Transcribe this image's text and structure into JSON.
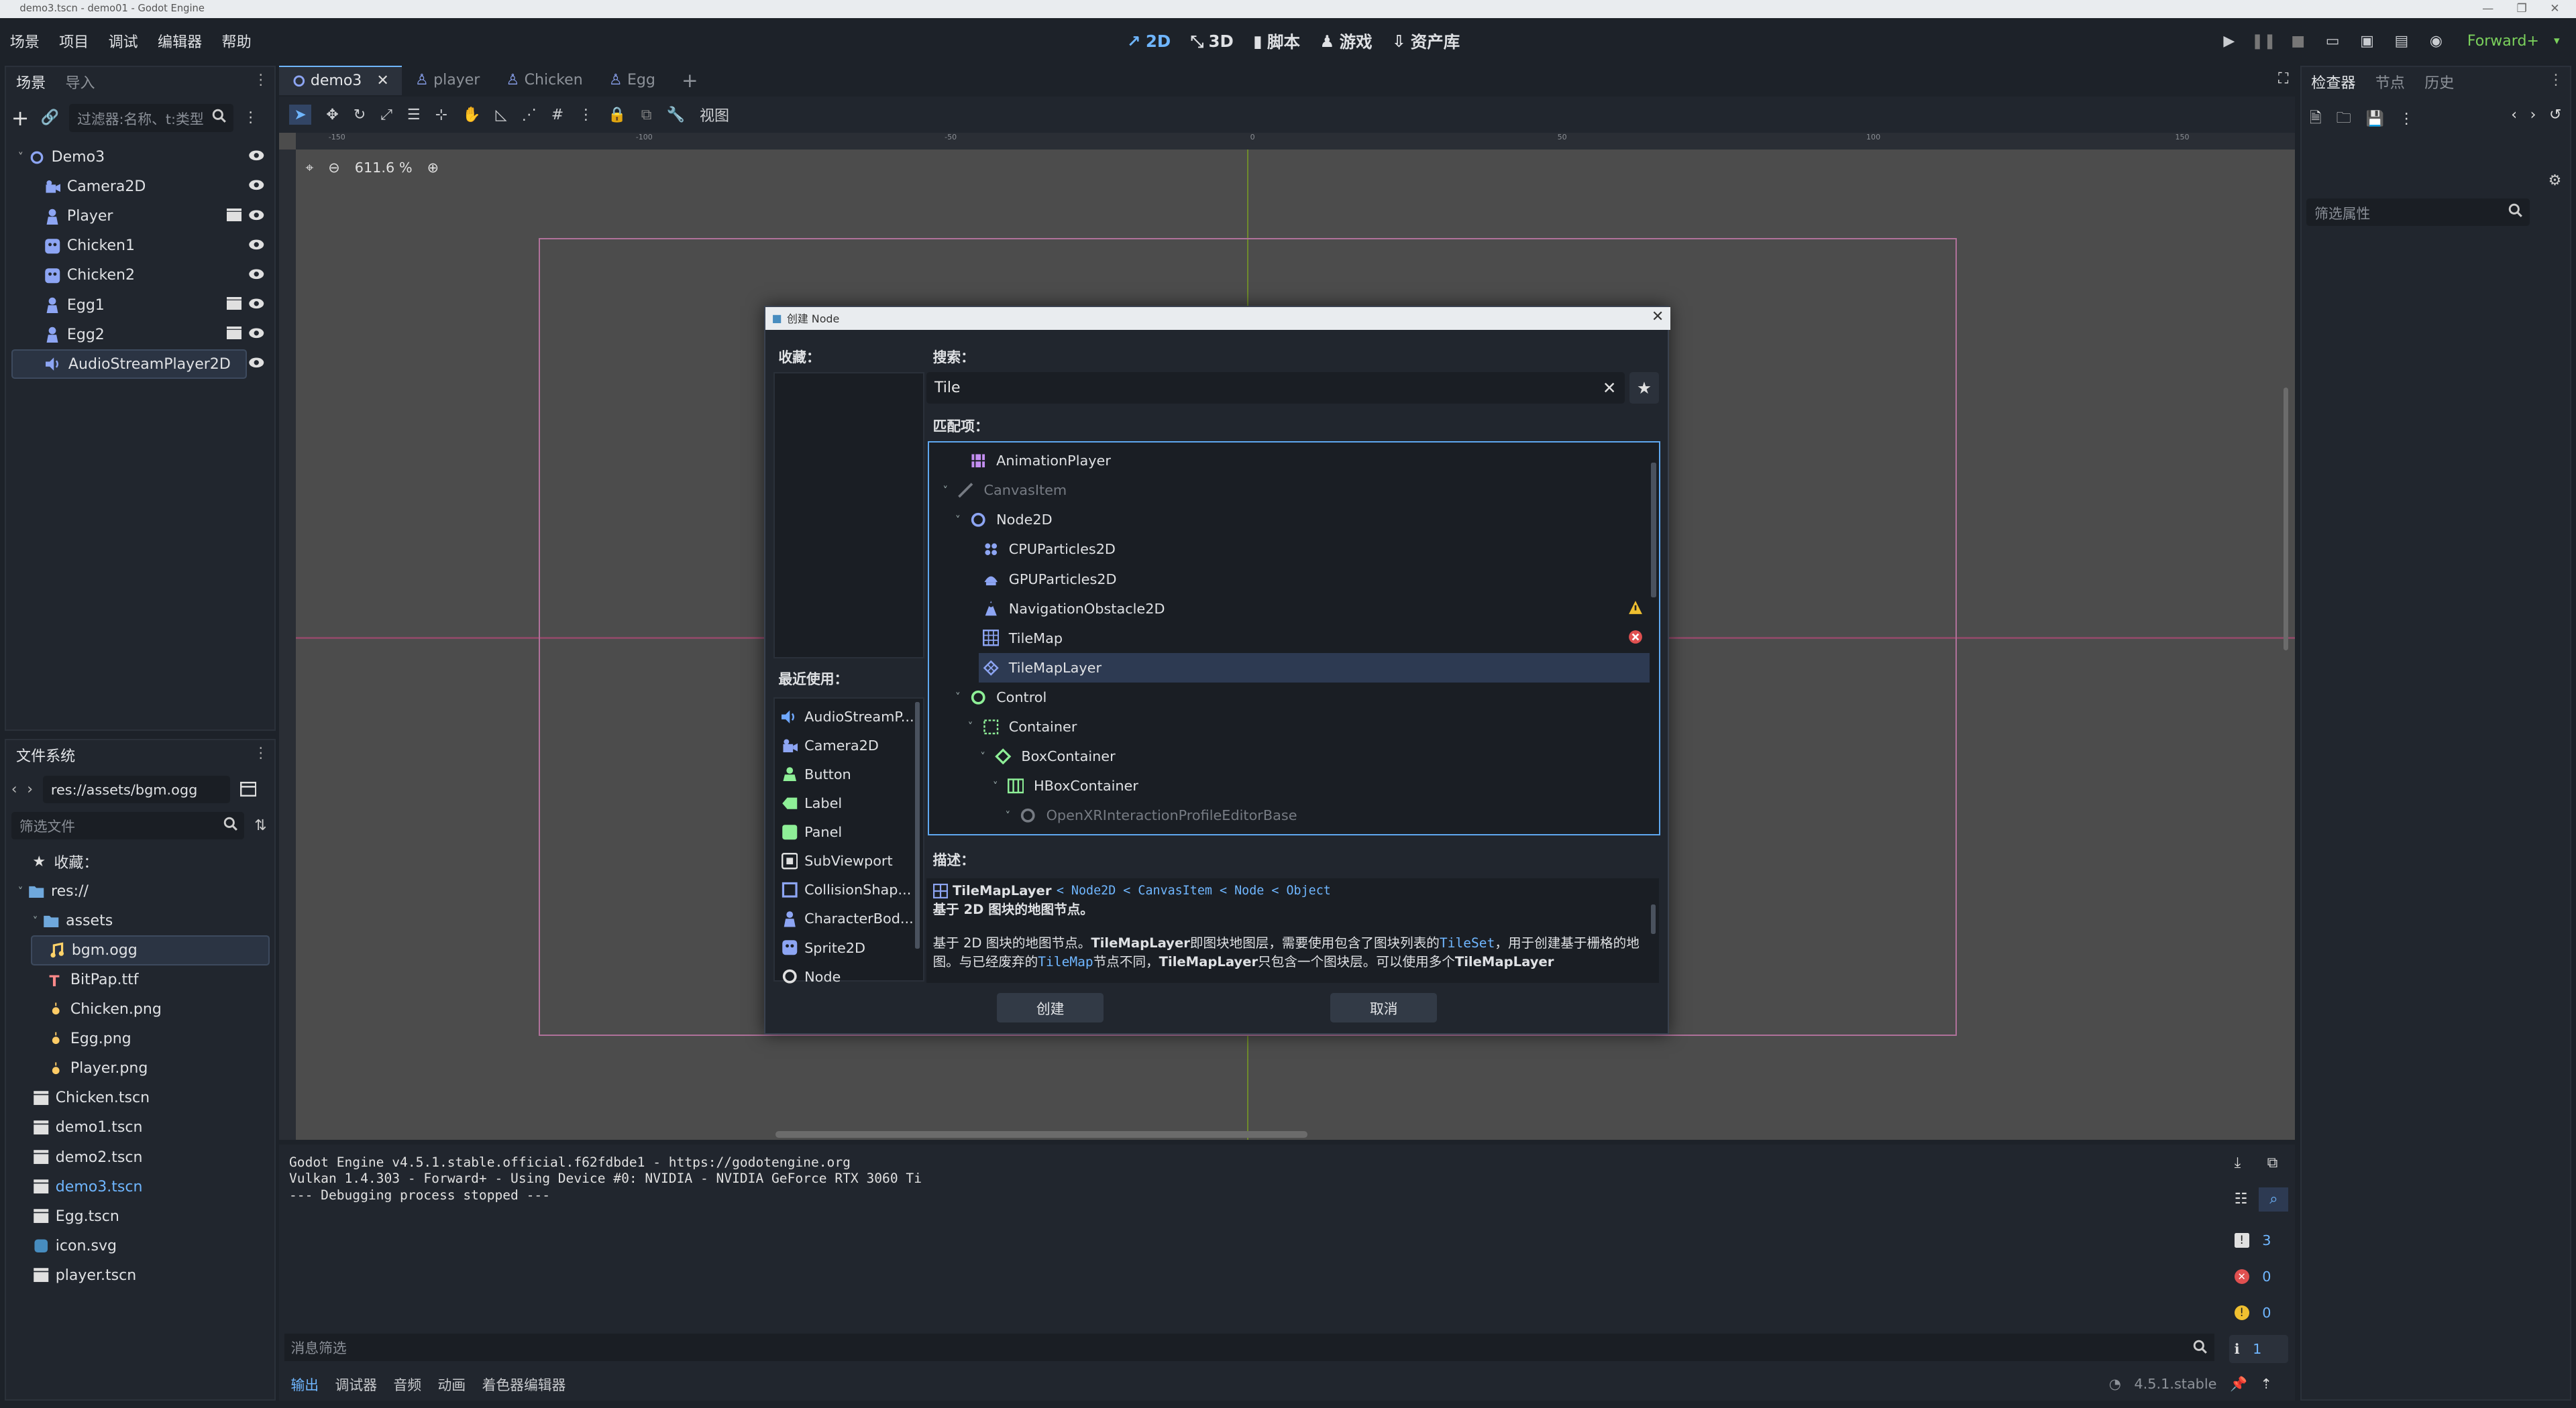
{
  "window": {
    "title": "demo3.tscn - demo01 - Godot Engine"
  },
  "menu": [
    "场景",
    "项目",
    "调试",
    "编辑器",
    "帮助"
  ],
  "main_screens": [
    "2D",
    "3D",
    "脚本",
    "游戏",
    "资产库"
  ],
  "renderer": "Forward+",
  "scene_dock": {
    "tabs": [
      "场景",
      "导入"
    ],
    "filter_placeholder": "过滤器:名称、t:类型",
    "nodes": [
      {
        "name": "Demo3",
        "icon": "node2d-icon"
      },
      {
        "name": "Camera2D",
        "icon": "camera2d-icon"
      },
      {
        "name": "Player",
        "icon": "characterbody-icon"
      },
      {
        "name": "Chicken1",
        "icon": "sprite-icon"
      },
      {
        "name": "Chicken2",
        "icon": "sprite-icon"
      },
      {
        "name": "Egg1",
        "icon": "characterbody-icon"
      },
      {
        "name": "Egg2",
        "icon": "characterbody-icon"
      },
      {
        "name": "AudioStreamPlayer2D",
        "icon": "speaker-icon"
      }
    ]
  },
  "filesystem": {
    "tab": "文件系统",
    "path": "res://assets/bgm.ogg",
    "filter_placeholder": "筛选文件",
    "favorites_label": "收藏：",
    "items": [
      {
        "name": "res://",
        "indent": 0,
        "type": "folder"
      },
      {
        "name": "assets",
        "indent": 1,
        "type": "folder"
      },
      {
        "name": "bgm.ogg",
        "indent": 2,
        "type": "audio"
      },
      {
        "name": "BitPap.ttf",
        "indent": 2,
        "type": "font"
      },
      {
        "name": "Chicken.png",
        "indent": 2,
        "type": "image"
      },
      {
        "name": "Egg.png",
        "indent": 2,
        "type": "image"
      },
      {
        "name": "Player.png",
        "indent": 2,
        "type": "image"
      },
      {
        "name": "Chicken.tscn",
        "indent": 1,
        "type": "scene"
      },
      {
        "name": "demo1.tscn",
        "indent": 1,
        "type": "scene"
      },
      {
        "name": "demo2.tscn",
        "indent": 1,
        "type": "scene"
      },
      {
        "name": "demo3.tscn",
        "indent": 1,
        "type": "scene"
      },
      {
        "name": "Egg.tscn",
        "indent": 1,
        "type": "scene"
      },
      {
        "name": "icon.svg",
        "indent": 1,
        "type": "svg"
      },
      {
        "name": "player.tscn",
        "indent": 1,
        "type": "scene"
      }
    ]
  },
  "scene_tabs": [
    "demo3",
    "player",
    "Chicken",
    "Egg"
  ],
  "viewport": {
    "view_menu": "视图",
    "zoom": "611.6 %",
    "ruler_labels": [
      "-150",
      "-100",
      "-50",
      "0",
      "50",
      "100",
      "150"
    ]
  },
  "inspector": {
    "tabs": [
      "检查器",
      "节点",
      "历史"
    ],
    "filter_placeholder": "筛选属性"
  },
  "console": {
    "lines": [
      "Godot Engine v4.5.1.stable.official.f62fdbde1 - https://godotengine.org",
      "Vulkan 1.4.303 - Forward+ - Using Device #0: NVIDIA - NVIDIA GeForce RTX 3060 Ti",
      "",
      "--- Debugging process stopped ---"
    ],
    "filter_placeholder": "消息筛选",
    "counts": {
      "messages": "3",
      "errors": "0",
      "warnings": "0",
      "info": "1"
    },
    "bottom_tabs": [
      "输出",
      "调试器",
      "音频",
      "动画",
      "着色器编辑器"
    ],
    "version": "4.5.1.stable"
  },
  "dialog": {
    "title": "创建 Node",
    "favorites_label": "收藏：",
    "search_label": "搜索：",
    "search_value": "Tile",
    "matches_label": "匹配项：",
    "recent_label": "最近使用：",
    "recent": [
      {
        "name": "AudioStreamP...",
        "icon": "speaker-icon",
        "color": "#6fa8ff"
      },
      {
        "name": "Camera2D",
        "icon": "camera2d-icon",
        "color": "#8da5f3"
      },
      {
        "name": "Button",
        "icon": "button-icon",
        "color": "#8eef97"
      },
      {
        "name": "Label",
        "icon": "label-icon",
        "color": "#8eef97"
      },
      {
        "name": "Panel",
        "icon": "panel-icon",
        "color": "#8eef97"
      },
      {
        "name": "SubViewport",
        "icon": "subviewport-icon",
        "color": "#e0e0e0"
      },
      {
        "name": "CollisionShap...",
        "icon": "collisionshape-icon",
        "color": "#8da5f3"
      },
      {
        "name": "CharacterBod...",
        "icon": "characterbody-icon",
        "color": "#8da5f3"
      },
      {
        "name": "Sprite2D",
        "icon": "sprite-icon",
        "color": "#8da5f3"
      },
      {
        "name": "Node",
        "icon": "node-icon",
        "color": "#e0e0e0"
      }
    ],
    "matches": [
      {
        "name": "AnimationPlayer",
        "indent": 3,
        "icon": "animationplayer-icon",
        "color": "#c38ef1"
      },
      {
        "name": "CanvasItem",
        "indent": 2,
        "icon": "canvasitem-icon",
        "color": "#e0e0e0",
        "dim": true
      },
      {
        "name": "Node2D",
        "indent": 3,
        "icon": "node2d-icon",
        "color": "#8da5f3"
      },
      {
        "name": "CPUParticles2D",
        "indent": 4,
        "icon": "cpuparticles-icon",
        "color": "#8da5f3"
      },
      {
        "name": "GPUParticles2D",
        "indent": 4,
        "icon": "gpuparticles-icon",
        "color": "#8da5f3"
      },
      {
        "name": "NavigationObstacle2D",
        "indent": 4,
        "icon": "navobstacle-icon",
        "color": "#8da5f3",
        "badge": "warning"
      },
      {
        "name": "TileMap",
        "indent": 4,
        "icon": "tilemap-icon",
        "color": "#8da5f3",
        "badge": "error"
      },
      {
        "name": "TileMapLayer",
        "indent": 4,
        "icon": "tilemaplayer-icon",
        "color": "#8da5f3",
        "selected": true
      },
      {
        "name": "Control",
        "indent": 3,
        "icon": "control-icon",
        "color": "#8eef97"
      },
      {
        "name": "Container",
        "indent": 4,
        "icon": "container-icon",
        "color": "#8eef97"
      },
      {
        "name": "BoxContainer",
        "indent": 5,
        "icon": "boxcontainer-icon",
        "color": "#8eef97"
      },
      {
        "name": "HBoxContainer",
        "indent": 6,
        "icon": "hboxcontainer-icon",
        "color": "#8eef97"
      },
      {
        "name": "OpenXRInteractionProfileEditorBase",
        "indent": 7,
        "icon": "control-icon",
        "color": "#8eef97",
        "dim": true
      }
    ],
    "description_label": "描述：",
    "desc_class": "TileMapLayer",
    "desc_inherits": "< Node2D < CanvasItem < Node < Object",
    "desc_brief": "基于 2D 图块的地图节点。",
    "desc_p1": "基于 2D 图块的地图节点。",
    "desc_p2": "即图块地图层，需要使用包含了图块列表的",
    "desc_tileset": "TileSet",
    "desc_p3": "，用于创建基于栅",
    "desc_p4": "格的地图。与已经废弃的",
    "desc_tilemap": "TileMap",
    "desc_p5": "节点不同，",
    "desc_p6": "只包含一个图块层。可以使用多个",
    "create_label": "创建",
    "cancel_label": "取消"
  },
  "colors": {
    "accent": "#6fb6ff",
    "node2d": "#8da5f3",
    "control": "#8eef97",
    "error": "#e05050",
    "warning": "#f0c030"
  }
}
